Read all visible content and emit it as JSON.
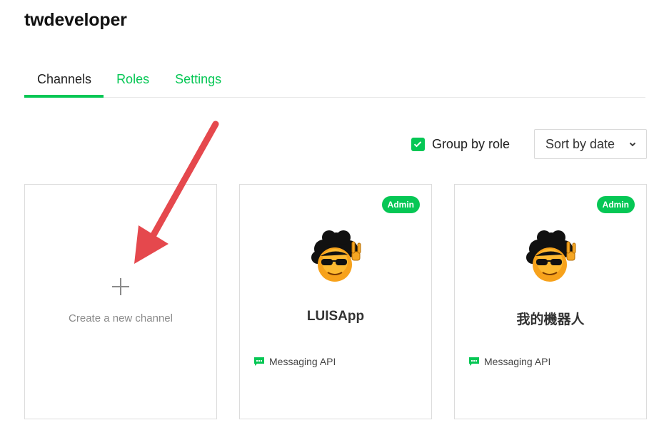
{
  "provider": {
    "name": "twdeveloper"
  },
  "tabs": [
    {
      "label": "Channels",
      "active": true
    },
    {
      "label": "Roles",
      "active": false
    },
    {
      "label": "Settings",
      "active": false
    }
  ],
  "toolbar": {
    "group_by_role_label": "Group by role",
    "group_by_role_checked": true,
    "sort_select_value": "Sort by date"
  },
  "create_card": {
    "label": "Create a new channel"
  },
  "channels": [
    {
      "name": "LUISApp",
      "badge": "Admin",
      "type_label": "Messaging API",
      "avatar_icon": "afro-emoji-avatar-icon"
    },
    {
      "name": "我的機器人",
      "badge": "Admin",
      "type_label": "Messaging API",
      "avatar_icon": "afro-emoji-avatar-icon"
    }
  ],
  "colors": {
    "brand_green": "#06c755",
    "annotation_red": "#e5484d"
  }
}
